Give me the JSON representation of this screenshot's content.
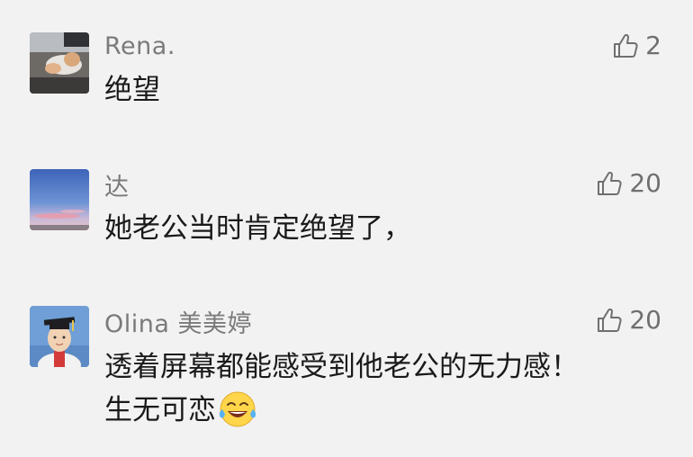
{
  "comments": [
    {
      "user": "Rena.",
      "text_lines": [
        "绝望"
      ],
      "likes": "2"
    },
    {
      "user": "达",
      "text_lines": [
        "她老公当时肯定绝望了，"
      ],
      "likes": "20"
    },
    {
      "user": "Olina 美美婷",
      "text_lines": [
        "透着屏幕都能感受到他老公的无力感！",
        "生无可恋"
      ],
      "likes": "20"
    }
  ],
  "icons": {
    "like": "thumbs-up-outline-icon",
    "emoji": "tears-of-joy-emoji"
  },
  "colors": {
    "background": "#f2f2f2",
    "username": "#7a7a7a",
    "text": "#1a1a1a",
    "like": "#6f6f6f"
  }
}
